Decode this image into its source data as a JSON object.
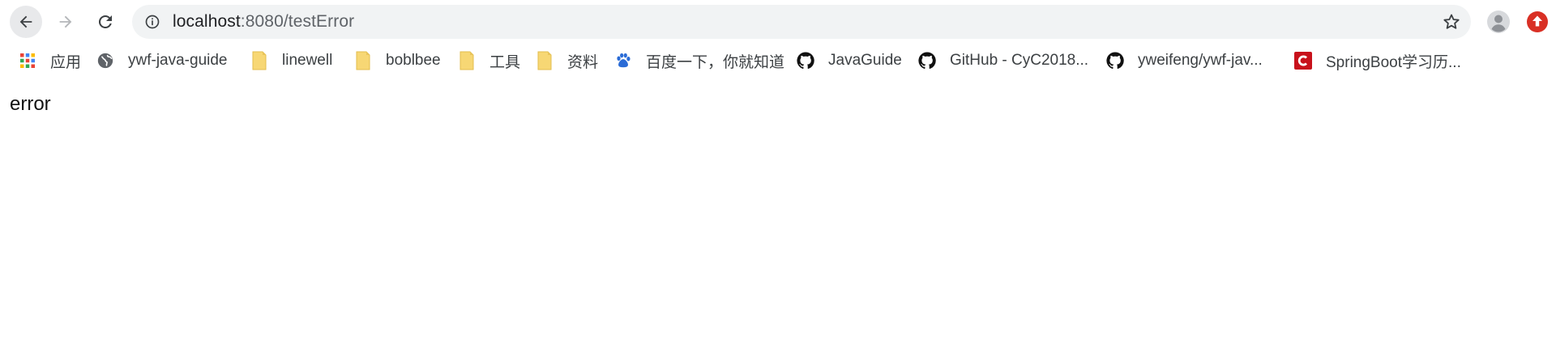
{
  "browser": {
    "url_host": "localhost",
    "url_rest": ":8080/testError"
  },
  "bookmarks": [
    {
      "label": "应用",
      "icon": "apps-grid-icon"
    },
    {
      "label": "ywf-java-guide",
      "icon": "globe-icon"
    },
    {
      "label": "linewell",
      "icon": "folder-icon"
    },
    {
      "label": "boblbee",
      "icon": "folder-icon"
    },
    {
      "label": "工具",
      "icon": "folder-icon"
    },
    {
      "label": "资料",
      "icon": "folder-icon"
    },
    {
      "label": "百度一下，你就知道",
      "icon": "baidu-paw-icon"
    },
    {
      "label": "JavaGuide",
      "icon": "github-icon"
    },
    {
      "label": "GitHub - CyC2018...",
      "icon": "github-icon"
    },
    {
      "label": "yweifeng/ywf-jav...",
      "icon": "github-icon"
    },
    {
      "label": "SpringBoot学习历...",
      "icon": "csdn-icon"
    }
  ],
  "page": {
    "message": "error"
  },
  "colors": {
    "folder": "#f7d774",
    "extension": "#d93025",
    "omnibox": "#f1f3f4"
  }
}
